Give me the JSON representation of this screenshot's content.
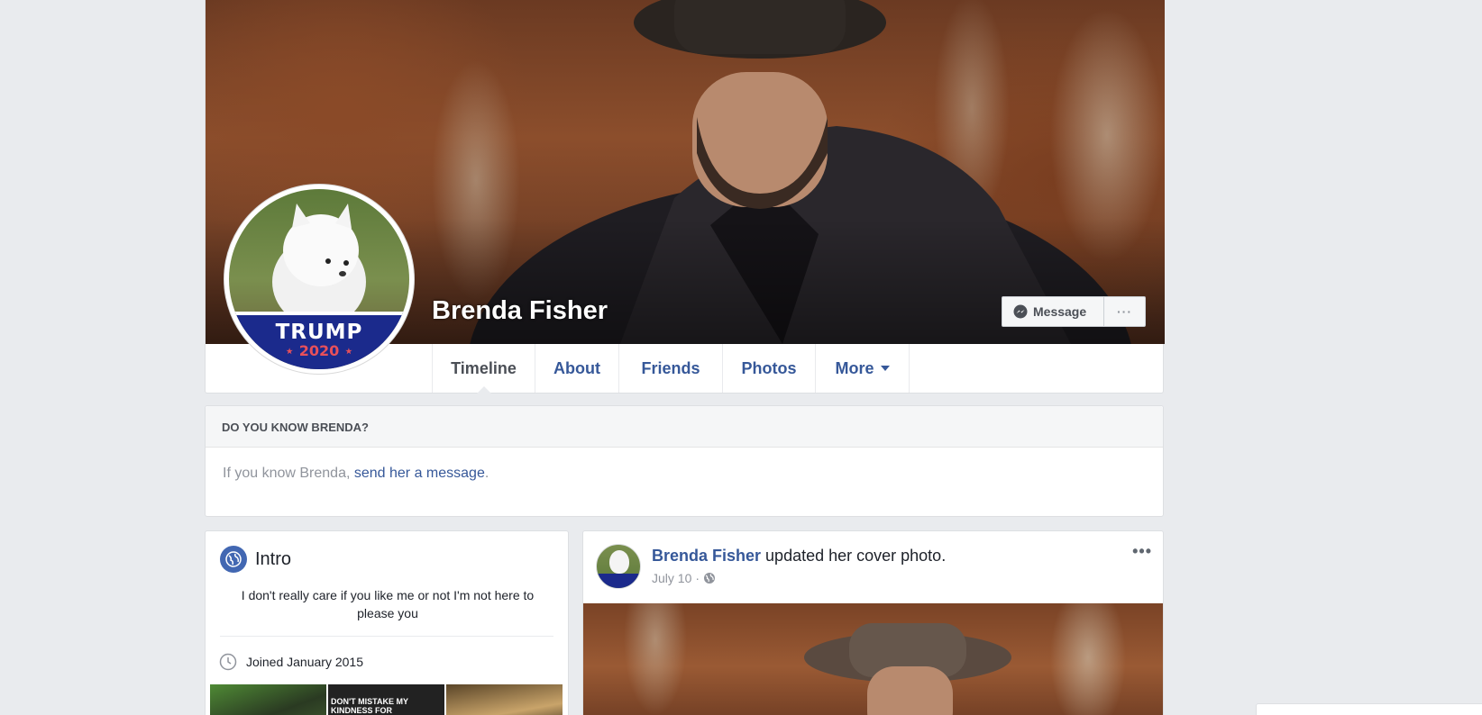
{
  "profile": {
    "name": "Brenda Fisher",
    "profile_pic_text": {
      "line1": "TRUMP",
      "line2": "⋆ 2020 ⋆"
    }
  },
  "cover_actions": {
    "message_label": "Message",
    "more_label": "···"
  },
  "tabs": [
    {
      "label": "Timeline",
      "active": true
    },
    {
      "label": "About"
    },
    {
      "label": "Friends"
    },
    {
      "label": "Photos"
    },
    {
      "label": "More"
    }
  ],
  "know_card": {
    "header": "DO YOU KNOW BRENDA?",
    "prefix": "If you know Brenda, ",
    "link": "send her a message",
    "suffix": "."
  },
  "intro": {
    "title": "Intro",
    "bio": "I don't really care if you like me or not I'm not here to please you",
    "joined": "Joined January 2015",
    "thumb2_text": "DON'T MISTAKE MY KINDNESS FOR"
  },
  "post": {
    "author": "Brenda Fisher",
    "action": " updated her cover photo.",
    "date": "July 10",
    "separator": "·",
    "menu": "•••"
  },
  "colors": {
    "link_blue": "#365899",
    "fb_blue": "#4267b2",
    "background": "#e9ebee"
  }
}
